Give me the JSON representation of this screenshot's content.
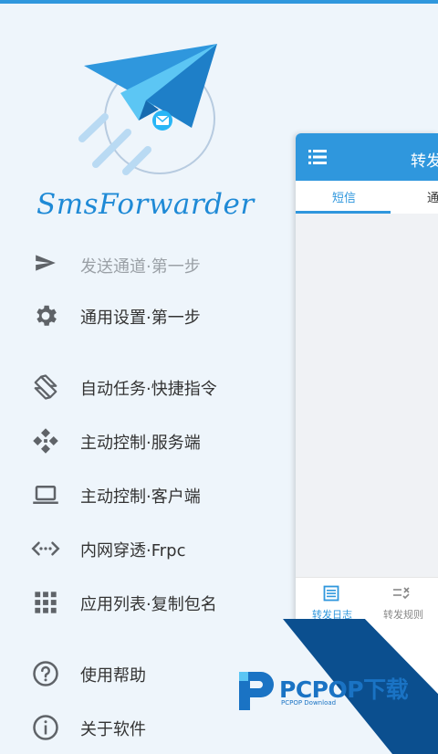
{
  "brand": {
    "name": "SmsForwarder"
  },
  "menu": {
    "cut_item": "发送通道·第一步",
    "items": [
      {
        "label": "通用设置·第一步"
      },
      {
        "label": "自动任务·快捷指令"
      },
      {
        "label": "主动控制·服务端"
      },
      {
        "label": "主动控制·客户端"
      },
      {
        "label": "内网穿透·Frpc"
      },
      {
        "label": "应用列表·复制包名"
      },
      {
        "label": "使用帮助"
      },
      {
        "label": "关于软件"
      }
    ]
  },
  "phone": {
    "header_title": "转发日志",
    "tabs": [
      "短信",
      "通话"
    ],
    "bottom_nav": [
      "转发日志",
      "转发规则"
    ]
  },
  "watermark": {
    "text": "PCPOP下载",
    "sub": "PCPOP Download"
  },
  "colors": {
    "accent": "#2f97dd",
    "dark_blue": "#0b4f8f"
  }
}
